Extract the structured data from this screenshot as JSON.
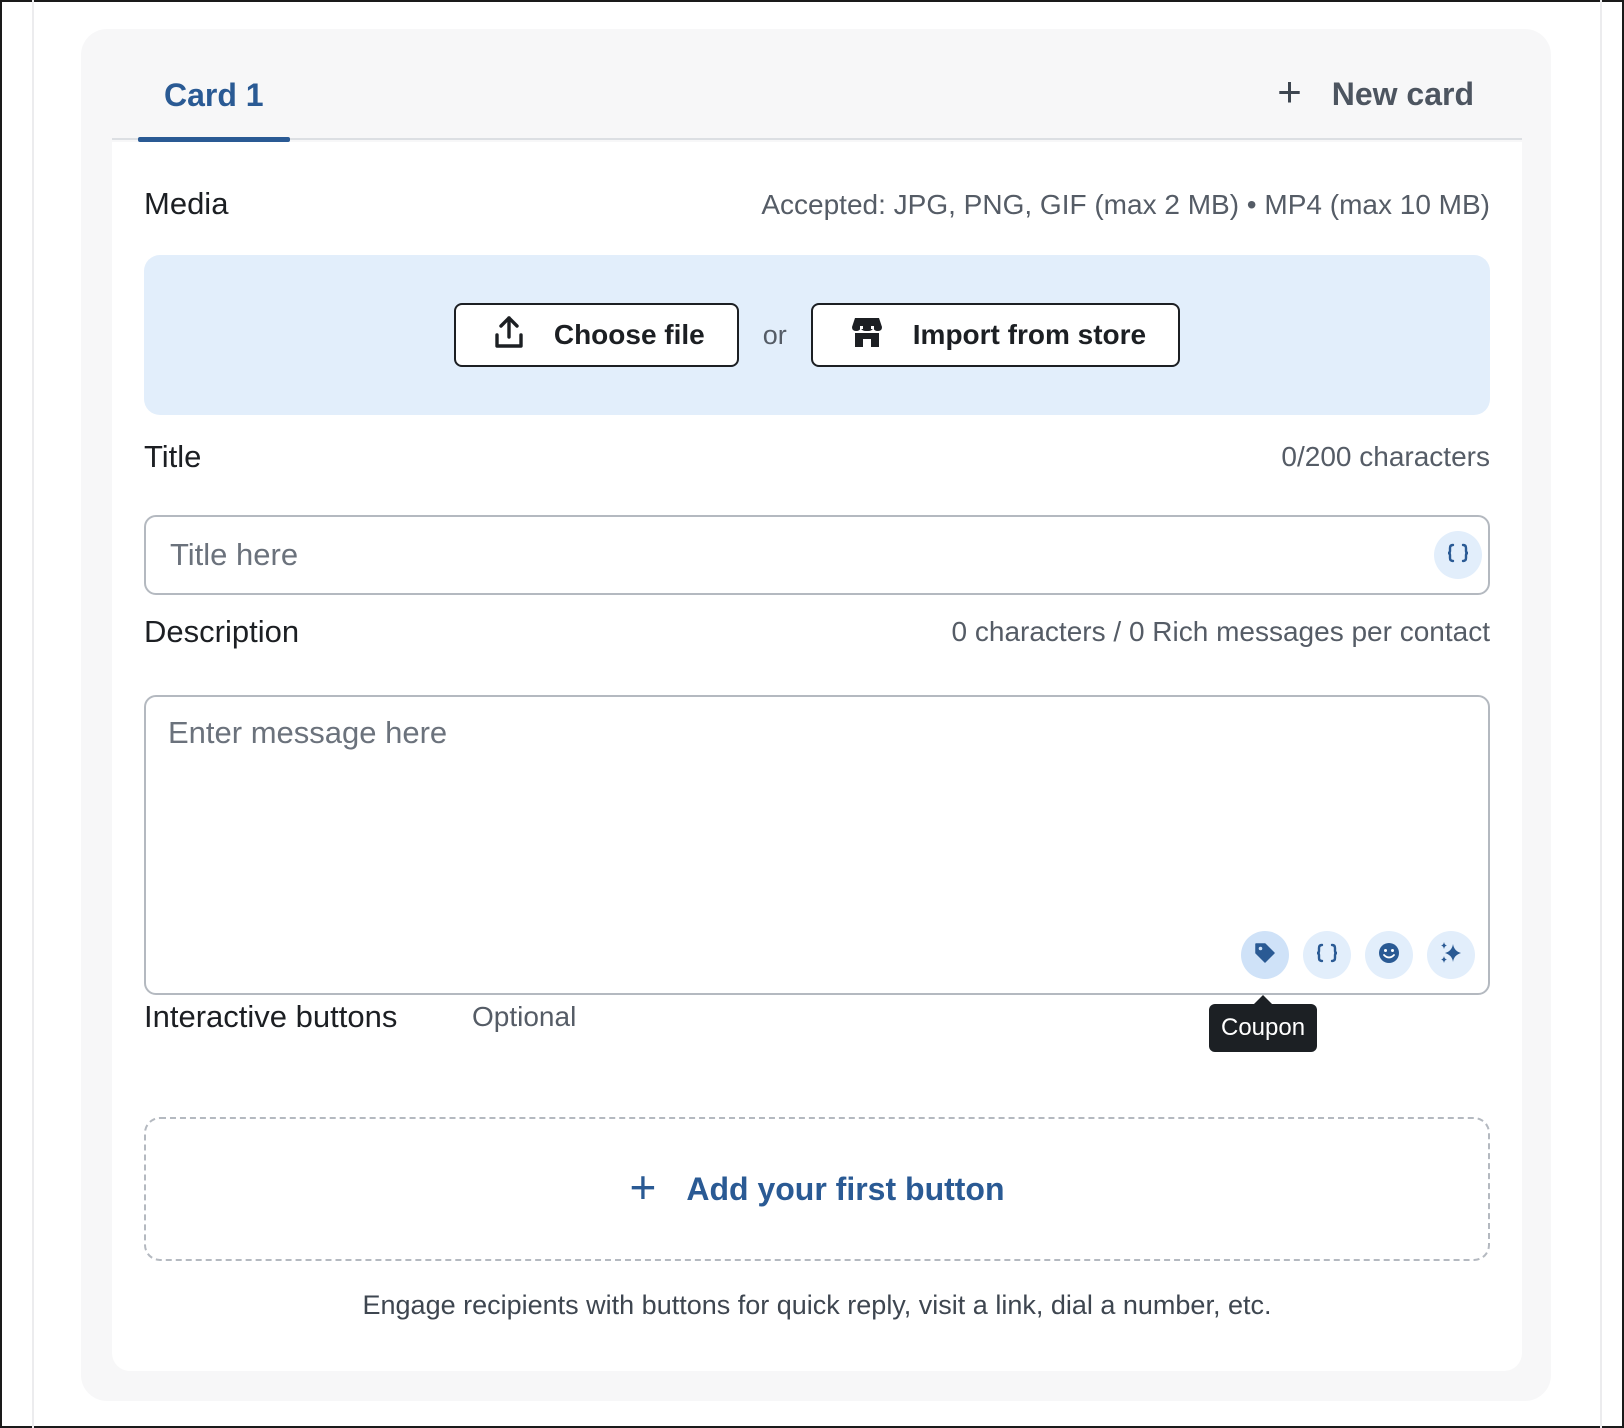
{
  "tabs": {
    "active_label": "Card 1",
    "new_card_label": "New card"
  },
  "media": {
    "label": "Media",
    "accepted": "Accepted: JPG, PNG, GIF (max 2 MB) • MP4 (max 10 MB)",
    "choose_file": "Choose file",
    "or": "or",
    "import_store": "Import from store"
  },
  "title": {
    "label": "Title",
    "counter": "0/200 characters",
    "placeholder": "Title here"
  },
  "description": {
    "label": "Description",
    "counter": "0 characters / 0 Rich messages per contact",
    "placeholder": "Enter message here",
    "tooltip": "Coupon"
  },
  "interactive": {
    "label": "Interactive buttons",
    "optional": "Optional",
    "add_first": "Add your first button",
    "helper": "Engage recipients with buttons for quick reply, visit a link, dial a number, etc."
  },
  "icons": {
    "upload": "upload-icon",
    "store": "store-icon",
    "variable": "curly-braces-icon",
    "coupon": "tag-icon",
    "emoji": "smiley-icon",
    "ai": "sparkles-icon",
    "plus": "plus-icon"
  },
  "colors": {
    "accent": "#2a5a94",
    "dropzone_bg": "#e2eefb",
    "tooltip_bg": "#1c2024"
  }
}
